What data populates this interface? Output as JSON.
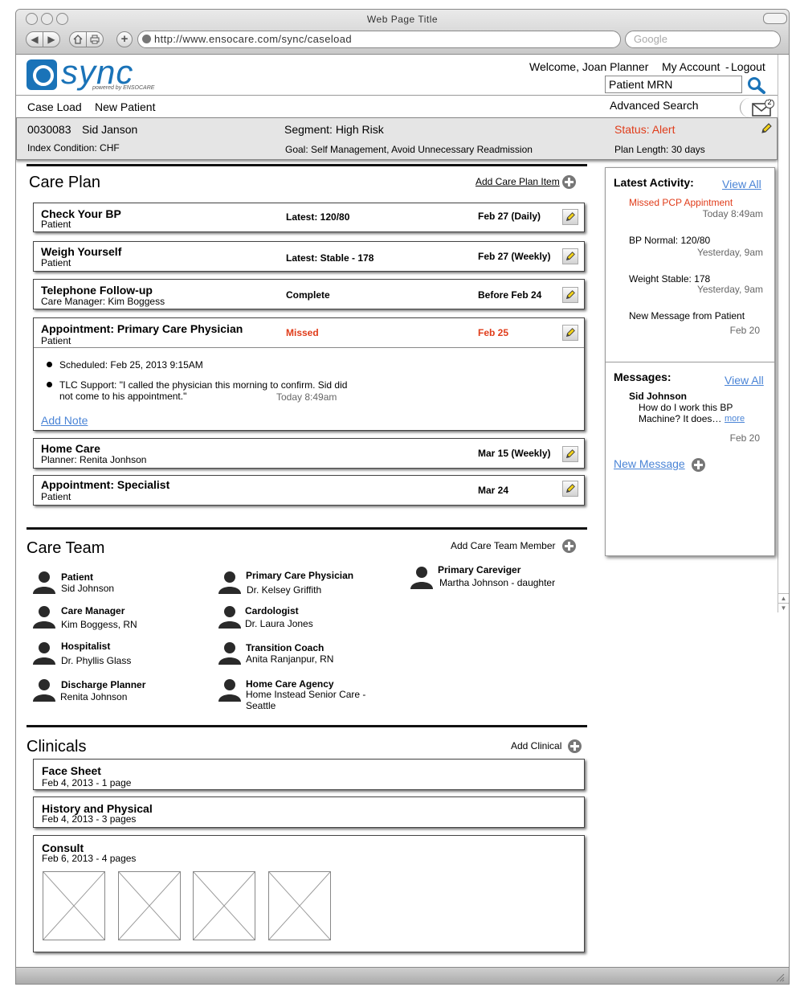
{
  "browser": {
    "title": "Web Page Title",
    "url": "http://www.ensocare.com/sync/caseload",
    "search_placeholder": "Google"
  },
  "brand": {
    "name": "sync",
    "tagline": "powered by ENSOCARE",
    "color": "#1a73b8"
  },
  "header": {
    "welcome": "Welcome, Joan Planner",
    "my_account": "My Account",
    "separator": "-",
    "logout": "Logout",
    "search_placeholder": "Patient MRN",
    "advanced_search": "Advanced Search",
    "message_count": "2"
  },
  "nav": {
    "case_load": "Case Load",
    "new_patient": "New Patient"
  },
  "patient": {
    "mrn": "0030083",
    "name": "Sid Janson",
    "segment": "Segment: High Risk",
    "status": "Status: Alert",
    "index_condition": "Index Condition: CHF",
    "goal": "Goal: Self Management, Avoid Unnecessary Readmission",
    "plan_length": "Plan Length: 30 days"
  },
  "care_plan": {
    "title": "Care Plan",
    "add_label": "Add Care Plan Item",
    "items": [
      {
        "title": "Check Your BP",
        "owner": "Patient",
        "status": "Latest: 120/80",
        "due": "Feb 27 (Daily)"
      },
      {
        "title": "Weigh Yourself",
        "owner": "Patient",
        "status": "Latest: Stable - 178",
        "due": "Feb 27 (Weekly)"
      },
      {
        "title": "Telephone Follow-up",
        "owner": "Care Manager: Kim Boggess",
        "status": "Complete",
        "due": "Before Feb 24"
      },
      {
        "title": "Appointment: Primary Care Physician",
        "owner": "Patient",
        "status": "Missed",
        "due": "Feb 25",
        "notes": [
          {
            "text": "Scheduled: Feb 25, 2013  9:15AM"
          },
          {
            "text": "TLC Support: \"I called the physician this morning to confirm. Sid did",
            "text2": "not come to his appointment.\"",
            "time": "Today 8:49am"
          }
        ],
        "add_note": "Add Note"
      },
      {
        "title": "Home Care",
        "owner": "Planner: Renita Jonhson",
        "status": "",
        "due": "Mar 15 (Weekly)"
      },
      {
        "title": "Appointment: Specialist",
        "owner": "Patient",
        "status": "",
        "due": "Mar 24"
      }
    ]
  },
  "care_team": {
    "title": "Care Team",
    "add_label": "Add Care Team Member",
    "members": [
      {
        "role": "Patient",
        "name": "Sid Johnson"
      },
      {
        "role": "Care Manager",
        "name": "Kim Boggess, RN"
      },
      {
        "role": "Hospitalist",
        "name": "Dr. Phyllis Glass"
      },
      {
        "role": "Discharge Planner",
        "name": "Renita Johnson"
      },
      {
        "role": "Primary Care  Physician",
        "name": "Dr. Kelsey Griffith"
      },
      {
        "role": "Cardologist",
        "name": "Dr. Laura  Jones"
      },
      {
        "role": "Transition Coach",
        "name": "Anita Ranjanpur, RN"
      },
      {
        "role": "Home Care Agency",
        "name": "Home Instead Senior Care -",
        "name2": "Seattle"
      },
      {
        "role": "Primary Careviger",
        "name": "Martha Johnson - daughter"
      }
    ]
  },
  "clinicals": {
    "title": "Clinicals",
    "add_label": "Add Clinical",
    "items": [
      {
        "title": "Face Sheet",
        "meta": "Feb 4, 2013 - 1 page"
      },
      {
        "title": "History and Physical",
        "meta": "Feb 4, 2013 - 3 pages"
      },
      {
        "title": "Consult",
        "meta": "Feb 6, 2013 - 4 pages"
      }
    ]
  },
  "activity": {
    "title": "Latest Activity:",
    "view_all": "View All",
    "items": [
      {
        "text": "Missed PCP Appintment",
        "time": "Today 8:49am"
      },
      {
        "text": "BP Normal: 120/80",
        "time": "Yesterday, 9am"
      },
      {
        "text": "Weight Stable: 178",
        "time": "Yesterday, 9am"
      },
      {
        "text": "New Message from Patient",
        "time": "Feb 20"
      }
    ]
  },
  "messages": {
    "title": "Messages:",
    "view_all": "View All",
    "items": [
      {
        "from": "Sid Johnson",
        "line1": "How do I work this BP",
        "line2": "Machine?  It does…",
        "more": "more",
        "time": "Feb 20"
      }
    ],
    "new_message": "New Message"
  }
}
